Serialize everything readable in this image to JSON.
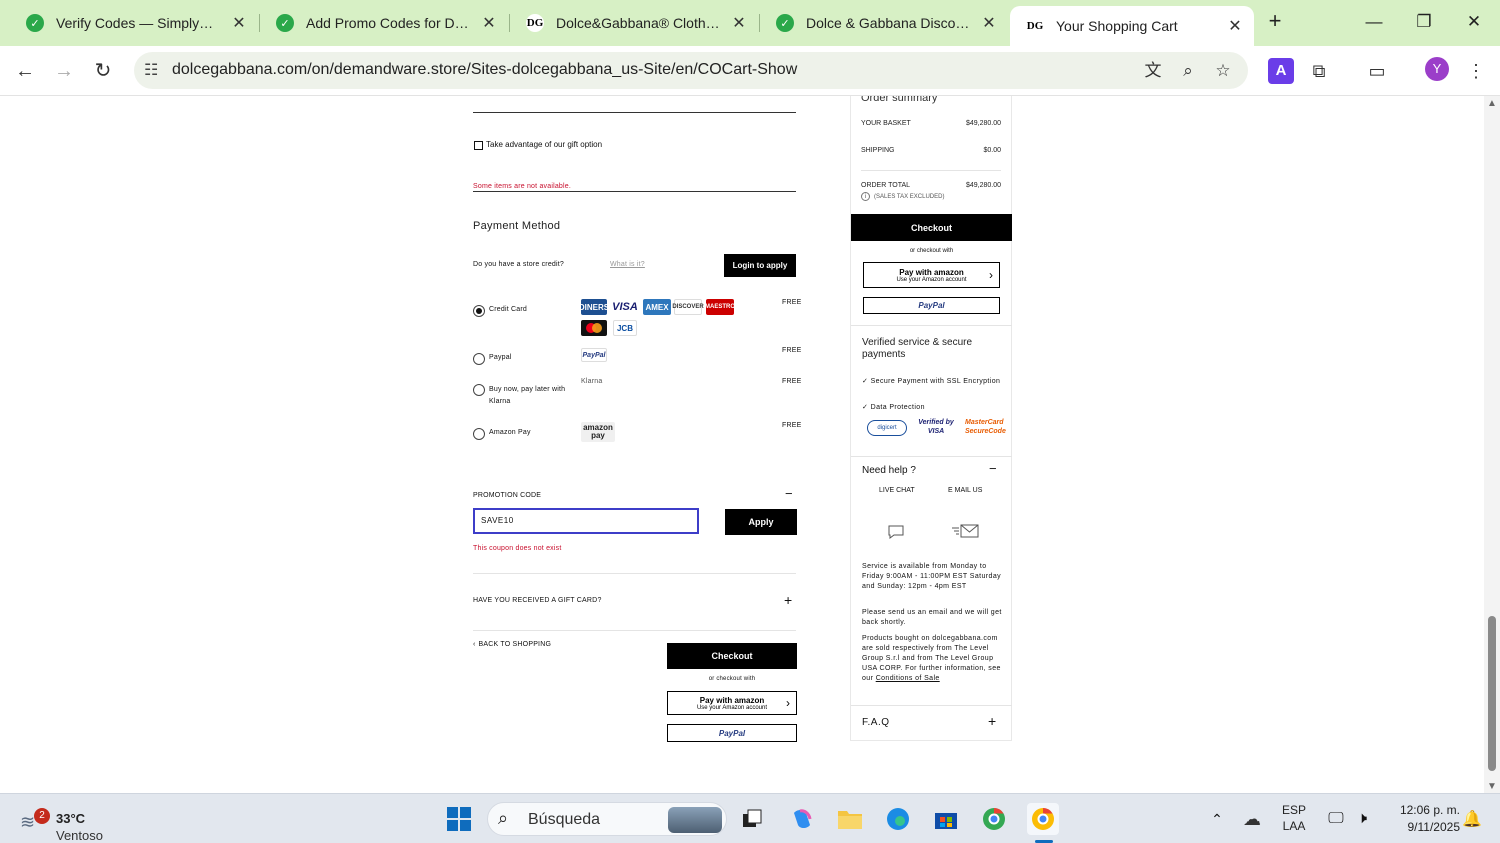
{
  "browser": {
    "tabs": [
      {
        "title": "Verify Codes — SimplyCodes",
        "active": false
      },
      {
        "title": "Add Promo Codes for Dolce &",
        "active": false
      },
      {
        "title": "Dolce&Gabbana® Clothing, D",
        "active": false
      },
      {
        "title": "Dolce & Gabbana Discount C",
        "active": false
      },
      {
        "title": "Your Shopping Cart",
        "active": true
      }
    ],
    "url": "dolcegabbana.com/on/demandware.store/Sites-dolcegabbana_us-Site/en/COCart-Show",
    "avatar_letter": "Y"
  },
  "cart": {
    "gift_option_label": "Take advantage of our gift option",
    "unavailable_notice": "Some items are not available.",
    "payment_method_title": "Payment Method",
    "store_credit_question": "Do you have a store credit?",
    "what_is_it": "What is it?",
    "login_to_apply": "Login to apply",
    "payment_options": [
      {
        "label": "Credit Card",
        "price": "FREE",
        "selected": true
      },
      {
        "label": "Paypal",
        "price": "FREE",
        "selected": false
      },
      {
        "label": "Buy now, pay later with Klarna",
        "price": "FREE",
        "selected": false
      },
      {
        "label": "Amazon Pay",
        "price": "FREE",
        "selected": false
      }
    ],
    "card_logos": [
      "DINERS",
      "VISA",
      "AMEX",
      "DISCOVER",
      "MAESTRO",
      "MC",
      "JCB"
    ],
    "paypal_logo_text": "PayPal",
    "klarna_logo_text": "Klarna",
    "amazon_pay_logo_text": "amazon pay",
    "promo_title": "PROMOTION CODE",
    "promo_toggle": "−",
    "promo_value": "SAVE10",
    "apply_label": "Apply",
    "promo_error": "This coupon does not exist",
    "gift_card_title": "HAVE YOU RECEIVED A GIFT CARD?",
    "gift_card_toggle": "+",
    "back_to_shopping": "BACK TO SHOPPING",
    "checkout_label": "Checkout",
    "or_checkout_with": "or checkout with",
    "amazon_line1": "Pay with amazon",
    "amazon_line2": "Use your Amazon account",
    "paypal_button": "PayPal"
  },
  "summary": {
    "title": "Order summary",
    "basket_label": "YOUR BASKET",
    "basket_value": "$49,280.00",
    "shipping_label": "SHIPPING",
    "shipping_value": "$0.00",
    "total_label": "ORDER TOTAL",
    "total_value": "$49,280.00",
    "tax_note": "(SALES TAX EXCLUDED)",
    "checkout_label": "Checkout",
    "or_checkout_with": "or checkout with",
    "amazon_line1": "Pay with amazon",
    "amazon_line2": "Use your Amazon account",
    "paypal_button": "PayPal",
    "verified_title": "Verified service & secure payments",
    "secure_line": "✓ Secure Payment with SSL Encryption",
    "protection_line": "✓ Data Protection",
    "badge_digicert": "digicert",
    "badge_visa": "Verified by VISA",
    "badge_mc": "MasterCard SecureCode",
    "help_title": "Need help ?",
    "help_toggle": "−",
    "live_chat": "LIVE CHAT",
    "email_us": "E MAIL US",
    "service_text": "Service is available from Monday to Friday 9:00AM - 11:00PM EST Saturday and Sunday: 12pm - 4pm EST",
    "email_text": "Please send us an email and we will get back shortly.",
    "products_text": "Products bought on dolcegabbana.com are sold respectively from The Level Group S.r.l and from The Level Group USA CORP. For further information, see our",
    "conditions_link": "Conditions of Sale",
    "faq_title": "F.A.Q",
    "faq_toggle": "+"
  },
  "taskbar": {
    "weather_temp": "33°C",
    "weather_desc": "Ventoso",
    "weather_badge": "2",
    "search_label": "Búsqueda",
    "lang_line1": "ESP",
    "lang_line2": "LAA",
    "time": "12:06 p. m.",
    "date": "9/11/2025"
  }
}
